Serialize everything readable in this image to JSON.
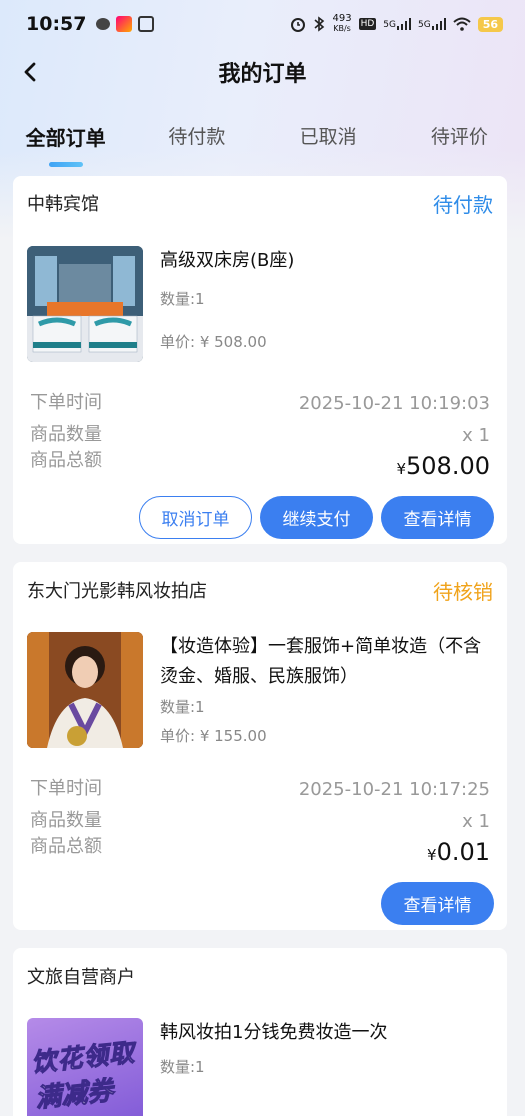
{
  "status_bar": {
    "time": "10:57",
    "net_speed_top": "493",
    "net_speed_bottom": "KB/s",
    "hd_label": "HD",
    "sig1": "5G",
    "sig2": "5G",
    "battery": "56"
  },
  "nav": {
    "title": "我的订单",
    "back_icon": "chevron-left-icon"
  },
  "tabs": [
    {
      "label": "全部订单"
    },
    {
      "label": "待付款"
    },
    {
      "label": "已取消"
    },
    {
      "label": "待评价"
    }
  ],
  "orders": [
    {
      "shop": "中韩宾馆",
      "status": "待付款",
      "status_color": "#2f8ce8",
      "product_name": "高级双床房(B座)",
      "quantity": "数量:1",
      "unit_price": "单价: ¥ 508.00",
      "order_time_label": "下单时间",
      "order_time": "2025-10-21 10:19:03",
      "count_label": "商品数量",
      "count": "x 1",
      "total_label": "商品总额",
      "currency": "¥",
      "total": "508.00",
      "buttons": [
        "取消订单",
        "继续支付",
        "查看详情"
      ]
    },
    {
      "shop": "东大门光影韩风妆拍店",
      "status": "待核销",
      "status_color": "#f0a31b",
      "product_name": "【妆造体验】一套服饰+简单妆造（不含烫金、婚服、民族服饰）",
      "quantity": "数量:1",
      "unit_price": "单价: ¥ 155.00",
      "order_time_label": "下单时间",
      "order_time": "2025-10-21 10:17:25",
      "count_label": "商品数量",
      "count": "x 1",
      "total_label": "商品总额",
      "currency": "¥",
      "total": "0.01",
      "buttons": [
        "查看详情"
      ]
    },
    {
      "shop": "文旅自营商户",
      "product_name": "韩风妆拍1分钱免费妆造一次",
      "quantity": "数量:1",
      "thumb_line1": "饮花领取",
      "thumb_line2": "满减券"
    }
  ]
}
